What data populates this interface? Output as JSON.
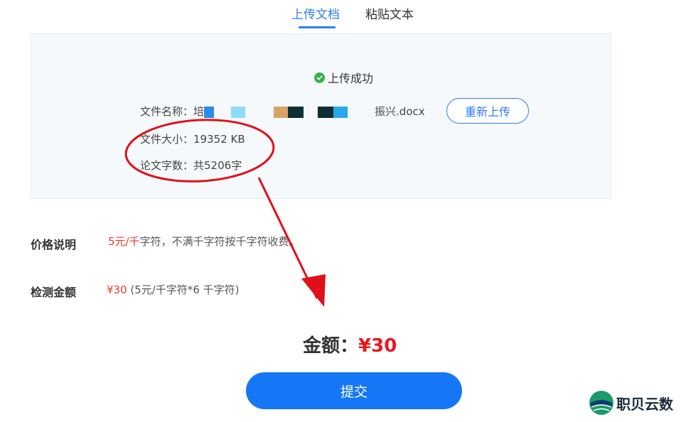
{
  "tabs": [
    {
      "label": "上传文档",
      "active": true
    },
    {
      "label": "粘贴文本",
      "active": false
    }
  ],
  "upload": {
    "status_text": "上传成功",
    "file_name_label": "文件名称：",
    "file_name_start": "培",
    "file_name_end": "振兴.docx",
    "file_size_label": "文件大小：",
    "file_size_value": "19352 KB",
    "word_count_label": "论文字数：",
    "word_count_value": "共5206字",
    "reupload_label": "重新上传"
  },
  "pricing": {
    "price_label": "价格说明",
    "price_rate": "5元/千",
    "price_rest": "字符，不满千字符按千字符收费。",
    "amount_label": "检测金额",
    "amount_value": "¥30",
    "amount_detail": " (5元/千字符*6 千字符)"
  },
  "total": {
    "label": "金额：",
    "value": "¥30"
  },
  "submit_label": "提交",
  "watermark": {
    "text": "职贝云数"
  },
  "colors": {
    "accent": "#2e7cf6",
    "price_red": "#e8382f",
    "success_green": "#35b34a",
    "annotation_red": "#e0101a"
  },
  "icons": [
    "check-circle-icon",
    "brand-logo-icon"
  ]
}
